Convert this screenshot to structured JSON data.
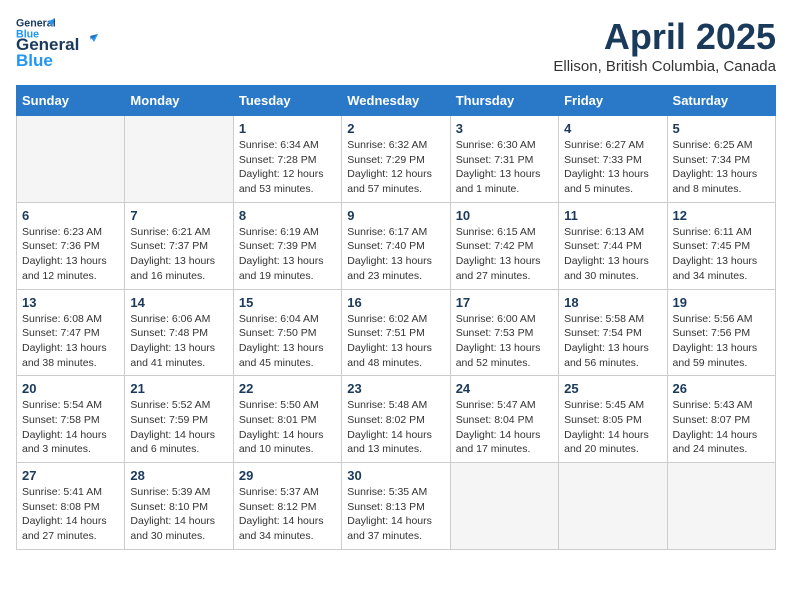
{
  "header": {
    "logo_line1": "General",
    "logo_line2": "Blue",
    "title": "April 2025",
    "subtitle": "Ellison, British Columbia, Canada"
  },
  "weekdays": [
    "Sunday",
    "Monday",
    "Tuesday",
    "Wednesday",
    "Thursday",
    "Friday",
    "Saturday"
  ],
  "weeks": [
    [
      {
        "day": "",
        "info": ""
      },
      {
        "day": "",
        "info": ""
      },
      {
        "day": "1",
        "info": "Sunrise: 6:34 AM\nSunset: 7:28 PM\nDaylight: 12 hours and 53 minutes."
      },
      {
        "day": "2",
        "info": "Sunrise: 6:32 AM\nSunset: 7:29 PM\nDaylight: 12 hours and 57 minutes."
      },
      {
        "day": "3",
        "info": "Sunrise: 6:30 AM\nSunset: 7:31 PM\nDaylight: 13 hours and 1 minute."
      },
      {
        "day": "4",
        "info": "Sunrise: 6:27 AM\nSunset: 7:33 PM\nDaylight: 13 hours and 5 minutes."
      },
      {
        "day": "5",
        "info": "Sunrise: 6:25 AM\nSunset: 7:34 PM\nDaylight: 13 hours and 8 minutes."
      }
    ],
    [
      {
        "day": "6",
        "info": "Sunrise: 6:23 AM\nSunset: 7:36 PM\nDaylight: 13 hours and 12 minutes."
      },
      {
        "day": "7",
        "info": "Sunrise: 6:21 AM\nSunset: 7:37 PM\nDaylight: 13 hours and 16 minutes."
      },
      {
        "day": "8",
        "info": "Sunrise: 6:19 AM\nSunset: 7:39 PM\nDaylight: 13 hours and 19 minutes."
      },
      {
        "day": "9",
        "info": "Sunrise: 6:17 AM\nSunset: 7:40 PM\nDaylight: 13 hours and 23 minutes."
      },
      {
        "day": "10",
        "info": "Sunrise: 6:15 AM\nSunset: 7:42 PM\nDaylight: 13 hours and 27 minutes."
      },
      {
        "day": "11",
        "info": "Sunrise: 6:13 AM\nSunset: 7:44 PM\nDaylight: 13 hours and 30 minutes."
      },
      {
        "day": "12",
        "info": "Sunrise: 6:11 AM\nSunset: 7:45 PM\nDaylight: 13 hours and 34 minutes."
      }
    ],
    [
      {
        "day": "13",
        "info": "Sunrise: 6:08 AM\nSunset: 7:47 PM\nDaylight: 13 hours and 38 minutes."
      },
      {
        "day": "14",
        "info": "Sunrise: 6:06 AM\nSunset: 7:48 PM\nDaylight: 13 hours and 41 minutes."
      },
      {
        "day": "15",
        "info": "Sunrise: 6:04 AM\nSunset: 7:50 PM\nDaylight: 13 hours and 45 minutes."
      },
      {
        "day": "16",
        "info": "Sunrise: 6:02 AM\nSunset: 7:51 PM\nDaylight: 13 hours and 48 minutes."
      },
      {
        "day": "17",
        "info": "Sunrise: 6:00 AM\nSunset: 7:53 PM\nDaylight: 13 hours and 52 minutes."
      },
      {
        "day": "18",
        "info": "Sunrise: 5:58 AM\nSunset: 7:54 PM\nDaylight: 13 hours and 56 minutes."
      },
      {
        "day": "19",
        "info": "Sunrise: 5:56 AM\nSunset: 7:56 PM\nDaylight: 13 hours and 59 minutes."
      }
    ],
    [
      {
        "day": "20",
        "info": "Sunrise: 5:54 AM\nSunset: 7:58 PM\nDaylight: 14 hours and 3 minutes."
      },
      {
        "day": "21",
        "info": "Sunrise: 5:52 AM\nSunset: 7:59 PM\nDaylight: 14 hours and 6 minutes."
      },
      {
        "day": "22",
        "info": "Sunrise: 5:50 AM\nSunset: 8:01 PM\nDaylight: 14 hours and 10 minutes."
      },
      {
        "day": "23",
        "info": "Sunrise: 5:48 AM\nSunset: 8:02 PM\nDaylight: 14 hours and 13 minutes."
      },
      {
        "day": "24",
        "info": "Sunrise: 5:47 AM\nSunset: 8:04 PM\nDaylight: 14 hours and 17 minutes."
      },
      {
        "day": "25",
        "info": "Sunrise: 5:45 AM\nSunset: 8:05 PM\nDaylight: 14 hours and 20 minutes."
      },
      {
        "day": "26",
        "info": "Sunrise: 5:43 AM\nSunset: 8:07 PM\nDaylight: 14 hours and 24 minutes."
      }
    ],
    [
      {
        "day": "27",
        "info": "Sunrise: 5:41 AM\nSunset: 8:08 PM\nDaylight: 14 hours and 27 minutes."
      },
      {
        "day": "28",
        "info": "Sunrise: 5:39 AM\nSunset: 8:10 PM\nDaylight: 14 hours and 30 minutes."
      },
      {
        "day": "29",
        "info": "Sunrise: 5:37 AM\nSunset: 8:12 PM\nDaylight: 14 hours and 34 minutes."
      },
      {
        "day": "30",
        "info": "Sunrise: 5:35 AM\nSunset: 8:13 PM\nDaylight: 14 hours and 37 minutes."
      },
      {
        "day": "",
        "info": ""
      },
      {
        "day": "",
        "info": ""
      },
      {
        "day": "",
        "info": ""
      }
    ]
  ]
}
